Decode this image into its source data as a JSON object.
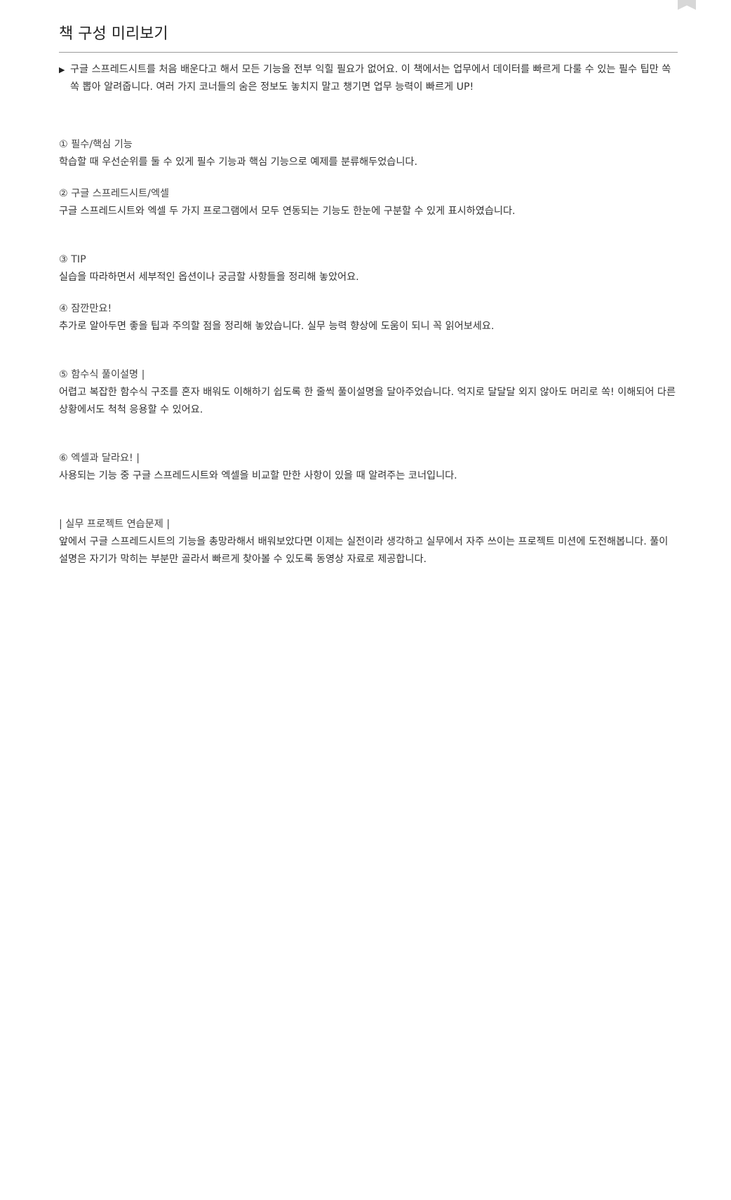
{
  "page": {
    "title": "책 구성 미리보기",
    "bookmark_icon": "bookmark-icon"
  },
  "intro": {
    "marker": "▶",
    "text": "구글 스프레드시트를 처음 배운다고 해서 모든 기능을 전부 익힐 필요가 없어요. 이 책에서는 업무에서 데이터를 빠르게 다룰 수 있는 필수 팁만 쏙 쏙 뽑아 알려줍니다. 여러 가지 코너들의 숨은 정보도 놓치지 말고 챙기면 업무 능력이 빠르게 UP!"
  },
  "sections": [
    {
      "heading": "① 필수/핵심 기능",
      "body": "학습할 때 우선순위를 둘 수 있게 필수 기능과 핵심 기능으로 예제를 분류해두었습니다."
    },
    {
      "heading": "② 구글 스프레드시트/엑셀",
      "body": "구글 스프레드시트와 엑셀 두 가지 프로그램에서 모두 연동되는 기능도 한눈에 구분할 수 있게 표시하였습니다."
    },
    {
      "heading": "③ TIP",
      "body": "실습을 따라하면서 세부적인 옵션이나 궁금할 사항들을 정리해 놓았어요."
    },
    {
      "heading": "④ 잠깐만요!",
      "body": "추가로 알아두면 좋을 팁과 주의할 점을 정리해 놓았습니다. 실무 능력 향상에 도움이 되니 꼭 읽어보세요."
    },
    {
      "heading": "⑤ 함수식 풀이설명 |",
      "body": "어렵고 복잡한 함수식 구조를 혼자 배워도 이해하기 쉽도록 한 줄씩 풀이설명을 달아주었습니다. 억지로 달달달 외지 않아도 머리로 쏙! 이해되어 다른 상황에서도 척척 응용할 수 있어요."
    },
    {
      "heading": "⑥ 엑셀과 달라요! |",
      "body": "사용되는 기능 중 구글 스프레드시트와 엑셀을 비교할 만한 사항이 있을 때 알려주는 코너입니다."
    },
    {
      "heading": "| 실무 프로젝트 연습문제 |",
      "body": "앞에서 구글 스프레드시트의 기능을 총망라해서 배워보았다면 이제는 실전이라 생각하고 실무에서 자주 쓰이는 프로젝트 미션에 도전해봅니다. 풀이 설명은 자기가 막히는 부분만 골라서 빠르게 찾아볼 수 있도록 동영상 자료로 제공합니다."
    }
  ]
}
